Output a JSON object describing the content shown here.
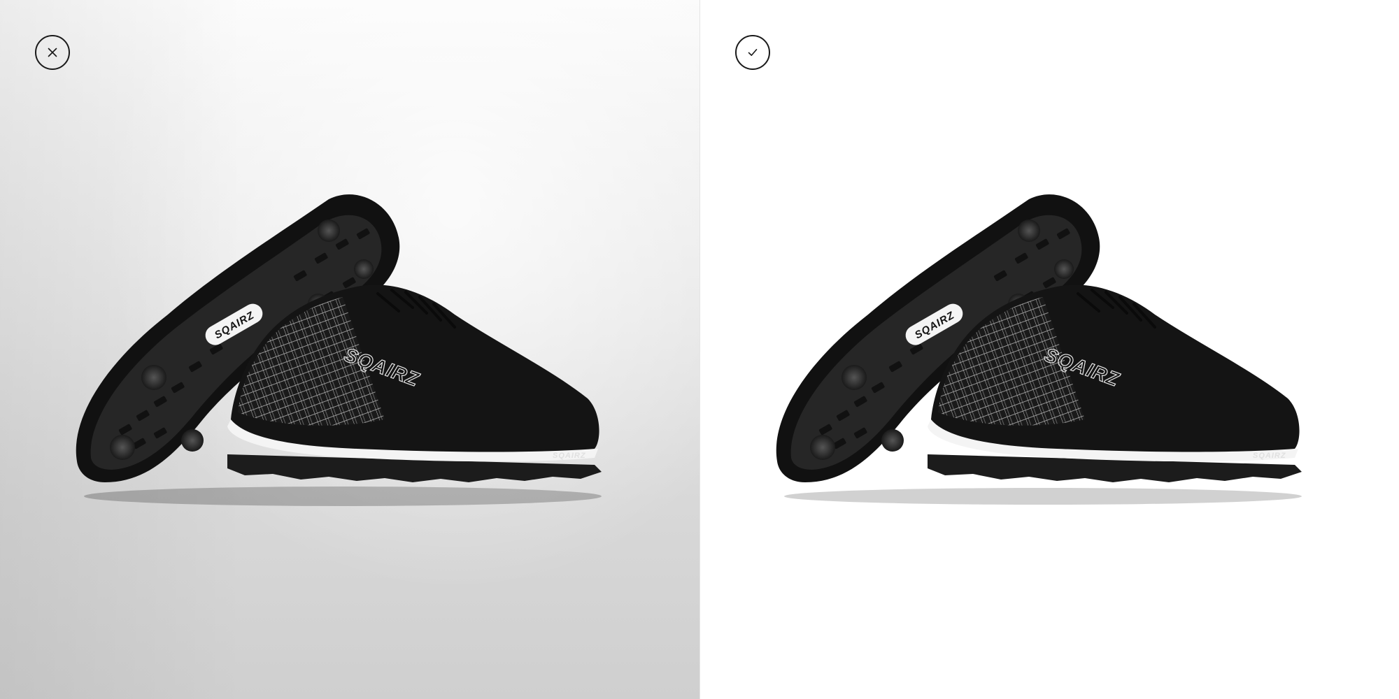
{
  "comparison": {
    "before": {
      "status": "rejected",
      "icon": "close-icon",
      "background": "grey studio gradient"
    },
    "after": {
      "status": "approved",
      "icon": "checkmark-icon",
      "background": "pure white"
    }
  },
  "product": {
    "heel_logo_text": "SQAIRZ",
    "side_logo_text": "SQAIRZ",
    "sole_logo_text": "SQAIRZ"
  },
  "colors": {
    "shoe_upper": "#141414",
    "sole_rubber": "#1c1c1c",
    "midsole": "#f4f4f4",
    "plaid_lines": "#d8d8d8",
    "badge_stroke": "#1a1a1a"
  }
}
